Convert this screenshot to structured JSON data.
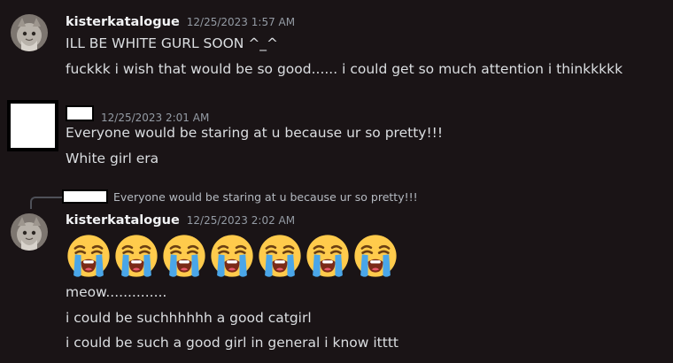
{
  "messages": [
    {
      "author": "kisterkatalogue",
      "timestamp": "12/25/2023 1:57 AM",
      "lines": [
        "ILL BE WHITE GURL SOON ^_^",
        "fuckkk i wish that would be so good...... i could get so much attention i thinkkkkk"
      ]
    },
    {
      "author": "",
      "timestamp": "12/25/2023 2:01 AM",
      "lines": [
        "Everyone would be staring at u because ur so pretty!!!",
        "White girl era"
      ]
    },
    {
      "reply_to": "Everyone would be staring at u because ur so pretty!!!",
      "author": "kisterkatalogue",
      "timestamp": "12/25/2023 2:02 AM",
      "emoji": [
        "loudly-crying-face",
        "loudly-crying-face",
        "loudly-crying-face",
        "loudly-crying-face",
        "loudly-crying-face",
        "loudly-crying-face",
        "loudly-crying-face"
      ],
      "lines": [
        "meow..............",
        "i could be suchhhhhh a good catgirl",
        "i could be such a good girl in general i know itttt"
      ]
    }
  ],
  "colors": {
    "background": "#1a1416",
    "text": "#dbdee1",
    "username": "#f2f3f5",
    "timestamp": "#949ba4"
  }
}
